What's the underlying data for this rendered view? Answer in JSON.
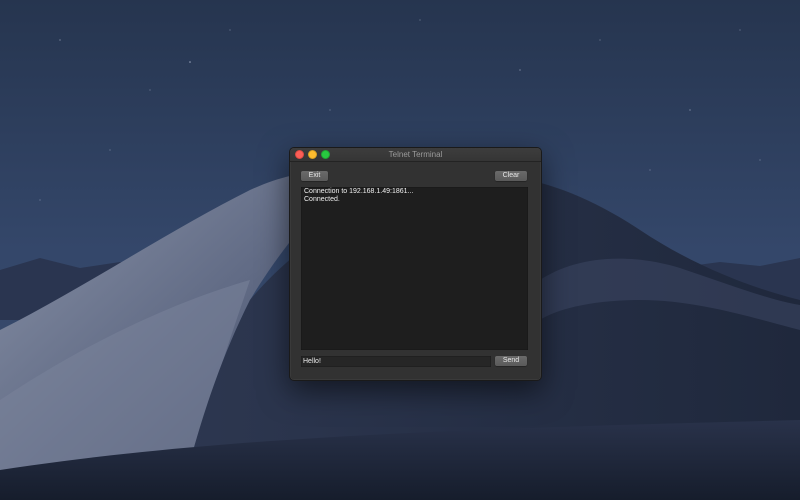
{
  "window": {
    "title": "Telnet Terminal"
  },
  "toolbar": {
    "exit_label": "Exit",
    "clear_label": "Clear"
  },
  "output": {
    "lines": [
      "Connection to 192.168.1.49:1861...",
      "Connected."
    ]
  },
  "input": {
    "value": "Hello!"
  },
  "send": {
    "label": "Send"
  },
  "colors": {
    "close": "#fd5f57",
    "minimize": "#febc2e",
    "maximize": "#28c840",
    "window_bg": "#323232",
    "output_bg": "#1e1e1e"
  },
  "icons": {
    "close": "close-icon",
    "minimize": "minimize-icon",
    "maximize": "maximize-icon"
  }
}
